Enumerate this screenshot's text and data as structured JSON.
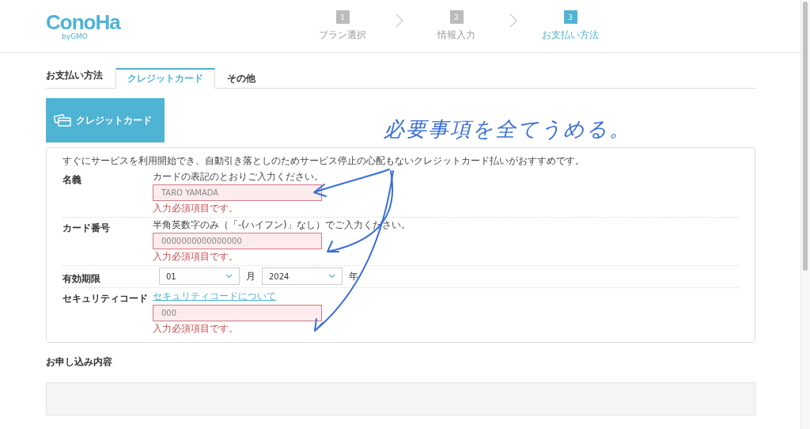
{
  "logo": {
    "name": "ConoHa",
    "by": "byGMO"
  },
  "steps": [
    {
      "number": "1",
      "label": "プラン選択",
      "selected": false
    },
    {
      "number": "2",
      "label": "情報入力",
      "selected": false
    },
    {
      "number": "3",
      "label": "お支払い方法",
      "selected": true
    }
  ],
  "payment": {
    "heading": "お支払い方法",
    "tabs": [
      {
        "label": "クレジットカード",
        "selected": true
      },
      {
        "label": "その他",
        "selected": false
      }
    ]
  },
  "method_card": {
    "label": "クレジットカード"
  },
  "form": {
    "intro": "すぐにサービスを利用開始でき、自動引き落としのためサービス停止の心配もないクレジットカード払いがおすすめです。",
    "rows": [
      {
        "kind": "text",
        "label": "名義",
        "hint": "カードの表記のとおりご入力ください。",
        "placeholder": "TARO YAMADA",
        "error": "入力必須項目です。",
        "invalid": true
      },
      {
        "kind": "text",
        "label": "カード番号",
        "hint": "半角英数字のみ（「-(ハイフン)」なし）でご入力ください。",
        "placeholder": "0000000000000000",
        "error": "入力必須項目です。",
        "invalid": true
      },
      {
        "kind": "expiry",
        "label": "有効期限",
        "month": "01",
        "month_unit": "月",
        "year": "2024",
        "year_unit": "年"
      },
      {
        "kind": "text",
        "label": "セキュリティコード",
        "link": "セキュリティコードについて",
        "placeholder": "000",
        "error": "入力必須項目です。",
        "invalid": true
      }
    ]
  },
  "annotation": {
    "text": "必要事項を全てうめる。"
  },
  "summary": {
    "heading": "お申し込み内容"
  }
}
